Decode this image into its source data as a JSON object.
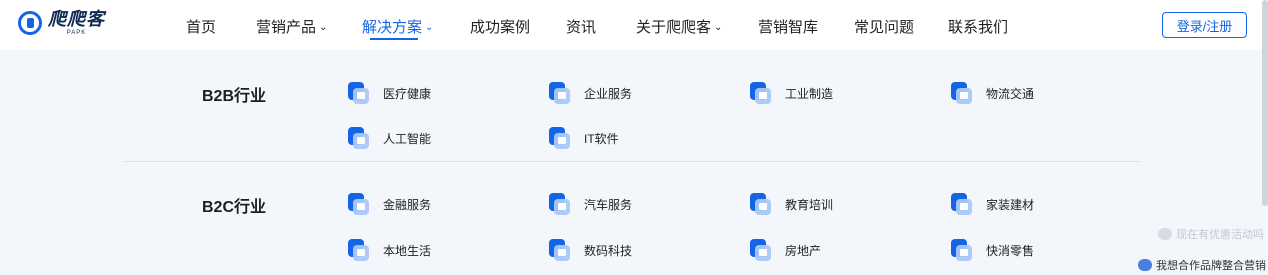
{
  "logo": {
    "name": "爬爬客",
    "sub": "PAPK"
  },
  "nav": [
    {
      "label": "首页",
      "caret": false
    },
    {
      "label": "营销产品",
      "caret": true
    },
    {
      "label": "解决方案",
      "caret": true
    },
    {
      "label": "成功案例",
      "caret": false
    },
    {
      "label": "资讯",
      "caret": false
    },
    {
      "label": "关于爬爬客",
      "caret": true
    },
    {
      "label": "营销智库",
      "caret": false
    },
    {
      "label": "常见问题",
      "caret": false
    },
    {
      "label": "联系我们",
      "caret": false
    }
  ],
  "active_nav": "解决方案",
  "login_label": "登录/注册",
  "accent_color": "#1464e6",
  "b2b": {
    "title": "B2B行业",
    "items": [
      "医疗健康",
      "企业服务",
      "工业制造",
      "物流交通",
      "人工智能",
      "IT软件"
    ]
  },
  "b2c": {
    "title": "B2C行业",
    "items": [
      "金融服务",
      "汽车服务",
      "教育培训",
      "家装建材",
      "本地生活",
      "数码科技",
      "房地产",
      "快消零售"
    ]
  },
  "float": {
    "tip1": "现在有优惠活动吗",
    "tip2": "我想合作品牌整合营销"
  }
}
